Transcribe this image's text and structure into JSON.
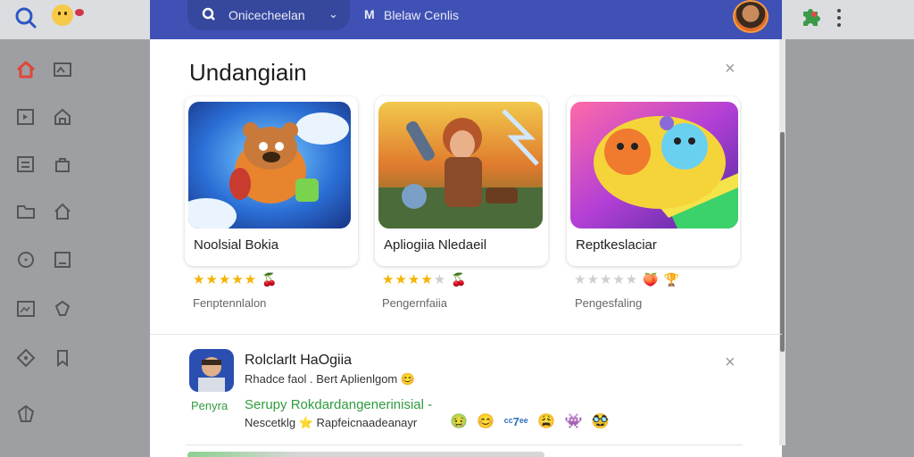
{
  "topbar": {
    "search_label": "Onicecheelan",
    "title_prefix": "M",
    "title": "Blelaw Cenlis"
  },
  "dialog": {
    "title": "Undangiain",
    "close": "×",
    "cards": [
      {
        "name": "Noolsial Bokia",
        "subtitle": "Fenptennlalon",
        "rating": 5,
        "stars_filled": "★★★★★",
        "stars_empty": "",
        "badge": "🍒"
      },
      {
        "name": "Apliogiia Nledaeil",
        "subtitle": "Pengernfaiia",
        "rating": 4,
        "stars_filled": "★★★★",
        "stars_empty": "★",
        "badge": "🍒"
      },
      {
        "name": "Reptkeslaciar",
        "subtitle": "Pengesfaling",
        "rating": 0,
        "stars_filled": "",
        "stars_empty": "★★★★★",
        "badge": "🍑 🏆"
      }
    ]
  },
  "notification": {
    "title": "Rolclarlt HaOgiia",
    "line1": "Rhadce faol . Bert Aplienlgom 😊",
    "tag": "Penyra",
    "link": "Serupy Rokdardangenerinisial -",
    "line2": "Nescetklg ⭐ Rapfeicnaadeanayr",
    "emojis": [
      "🤢",
      "😊",
      "ᶜᶜ7ᵉᵉ",
      "😩",
      "👾",
      "🥸"
    ],
    "close": "×"
  }
}
